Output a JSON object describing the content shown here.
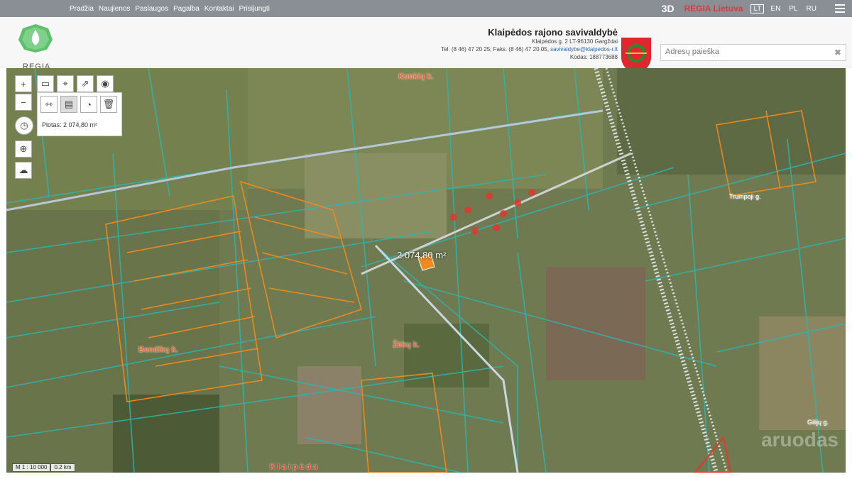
{
  "topnav": {
    "items": [
      "Pradžia",
      "Naujienos",
      "Paslaugos",
      "Pagalba",
      "Kontaktai",
      "Prisijungti"
    ],
    "btn3d": "3D",
    "regia_lt": "REGIA Lietuva",
    "languages": [
      "LT",
      "EN",
      "PL",
      "RU"
    ],
    "active_language": "LT"
  },
  "header": {
    "logo_text": "REGIA",
    "municipality": "Klaipėdos rajono savivaldybė",
    "address": "Klaipėdos g. 2 LT-96130 Gargždai",
    "contacts_prefix": "Tel. (8 46) 47 20 25; Faks. (8 46) 47 20 05,",
    "email": "savivaldybe@klaipedos-r.lt",
    "code": "Kodas: 188773688",
    "search_placeholder": "Adresų paieška"
  },
  "map": {
    "area_label": "Plotas: 2 074,80 m²",
    "parcel_area": "2 074,80 m²",
    "scale_ratio": "M 1 : 10 000",
    "scale_distance": "0.2 km",
    "place_labels": [
      "Kunkių k.",
      "Bendikų k.",
      "Žėkų k.",
      "Klaipėda",
      "Trumpoji g.",
      "Gilijų g."
    ],
    "watermark": "aruodas"
  },
  "colors": {
    "topbar": "#8a8f96",
    "parcel_teal": "#2bb6b0",
    "parcel_orange": "#f08a1c",
    "accent_red": "#d93b3b"
  }
}
